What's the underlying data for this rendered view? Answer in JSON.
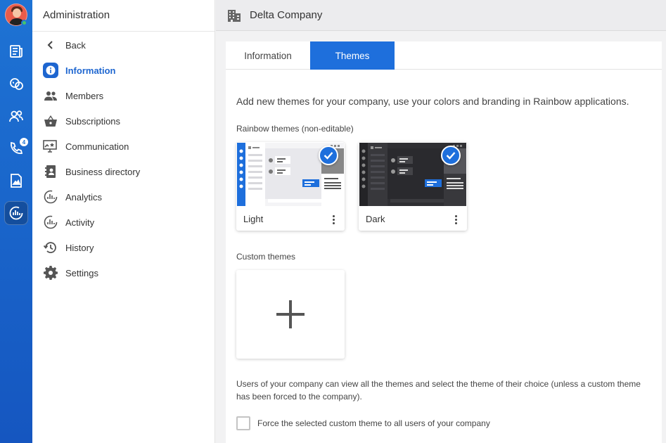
{
  "rail": {
    "items": [
      {
        "name": "news-icon",
        "badge": null
      },
      {
        "name": "conversations-icon",
        "badge": null
      },
      {
        "name": "contacts-icon",
        "badge": null
      },
      {
        "name": "calls-icon",
        "badge": "4"
      },
      {
        "name": "files-icon",
        "badge": null
      },
      {
        "name": "admin-icon",
        "badge": null
      }
    ],
    "active": "admin-icon",
    "colors": {
      "top": "#1e73d4",
      "bottom": "#1556c0"
    }
  },
  "sidebar": {
    "title": "Administration",
    "back_label": "Back",
    "items": [
      {
        "label": "Information",
        "icon": "info-icon",
        "active": true
      },
      {
        "label": "Members",
        "icon": "members-icon",
        "active": false
      },
      {
        "label": "Subscriptions",
        "icon": "basket-icon",
        "active": false
      },
      {
        "label": "Communication",
        "icon": "monitor-star-icon",
        "active": false
      },
      {
        "label": "Business directory",
        "icon": "contact-book-icon",
        "active": false
      },
      {
        "label": "Analytics",
        "icon": "analytics-icon",
        "active": false
      },
      {
        "label": "Activity",
        "icon": "activity-icon",
        "active": false
      },
      {
        "label": "History",
        "icon": "history-icon",
        "active": false
      },
      {
        "label": "Settings",
        "icon": "gear-icon",
        "active": false
      }
    ]
  },
  "header": {
    "title": "Delta Company",
    "icon": "building-icon"
  },
  "tabs": [
    {
      "label": "Information",
      "active": false
    },
    {
      "label": "Themes",
      "active": true
    }
  ],
  "themes": {
    "intro": "Add new themes for your company, use your colors and branding in Rainbow applications.",
    "rainbow_label": "Rainbow themes (non-editable)",
    "rainbow_themes": [
      {
        "name": "Light",
        "selected": true
      },
      {
        "name": "Dark",
        "selected": true
      }
    ],
    "custom_label": "Custom themes",
    "add_label": "+",
    "note": "Users of your company can view all the themes and select the theme of their choice (unless a custom theme has been forced to the company).",
    "force_label": "Force the selected custom theme to all users of your company",
    "force_checked": false
  },
  "colors": {
    "accent": "#1e6fdc",
    "active_text": "#1e66d0"
  }
}
